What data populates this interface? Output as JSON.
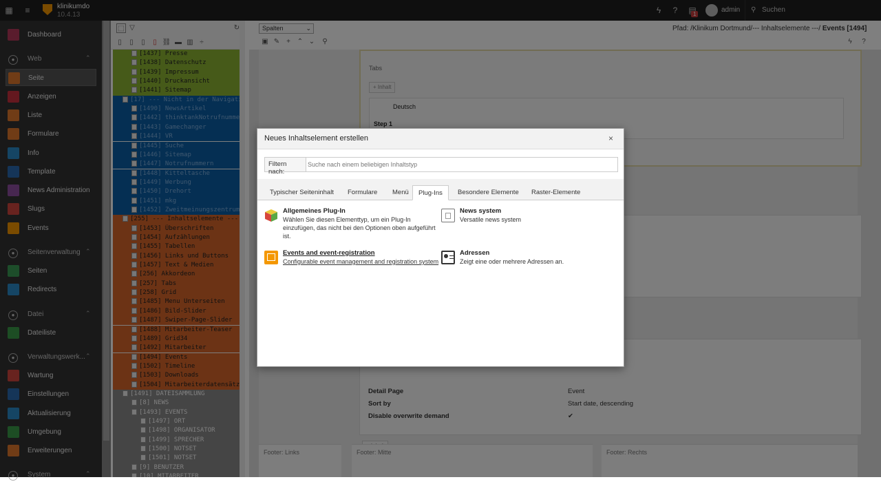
{
  "topbar": {
    "site_name": "klinikumdo",
    "version": "10.4.13",
    "username": "admin",
    "search_label": "Suchen",
    "badge_count": "1"
  },
  "sidebar": {
    "sections": [
      {
        "label": "Web",
        "items": [
          "Seite",
          "Anzeigen",
          "Liste",
          "Formulare",
          "Info",
          "Template",
          "News Administration",
          "Slugs",
          "Events"
        ]
      },
      {
        "label": "Seitenverwaltung",
        "items": [
          "Seiten",
          "Redirects"
        ]
      },
      {
        "label": "Datei",
        "items": [
          "Dateiliste"
        ]
      },
      {
        "label": "Verwaltungswerk...",
        "items": [
          "Wartung",
          "Einstellungen",
          "Aktualisierung",
          "Umgebung",
          "Erweiterungen"
        ]
      },
      {
        "label": "System",
        "items": []
      }
    ],
    "dashboard": "Dashboard",
    "active": "Seite",
    "item_colors": {
      "Dashboard": "#b5385b",
      "Seite": "#e0782c",
      "Anzeigen": "#c8313f",
      "Liste": "#e0782c",
      "Formulare": "#e0782c",
      "Info": "#2b8ac8",
      "Template": "#2b6bb0",
      "News Administration": "#8f4fa0",
      "Slugs": "#d0463e",
      "Events": "#f49700",
      "Seiten": "#3b9b55",
      "Redirects": "#2b8ac8",
      "Dateiliste": "#3a9b48",
      "Wartung": "#d0463e",
      "Einstellungen": "#2b6bb0",
      "Aktualisierung": "#2b8ac8",
      "Umgebung": "#3a9b48",
      "Erweiterungen": "#e0782c"
    }
  },
  "tree": {
    "nodes": [
      {
        "text": "[1437] Presse",
        "color": "#8db533",
        "indent": 1
      },
      {
        "text": "[1438] Datenschutz",
        "color": "#8db533",
        "indent": 1
      },
      {
        "text": "[1439] Impressum",
        "color": "#8db533",
        "indent": 1
      },
      {
        "text": "[1440] Druckansicht",
        "color": "#8db533",
        "indent": 1
      },
      {
        "text": "[1441] Sitemap",
        "color": "#8db533",
        "indent": 1
      },
      {
        "text": "[17] --- Nicht in der Navigation ---",
        "color": "#0a5fa6",
        "indent": 0
      },
      {
        "text": "[1490] NewsArtikel",
        "color": "#0a5fa6",
        "indent": 1
      },
      {
        "text": "[1442] thinktankNotrufnummer",
        "color": "#0a5fa6",
        "indent": 1
      },
      {
        "text": "[1443] Gamechanger",
        "color": "#0a5fa6",
        "indent": 1
      },
      {
        "text": "[1444] VR",
        "color": "#0a5fa6",
        "indent": 1
      },
      {
        "text": "[1445] Suche",
        "color": "#0a5fa6",
        "indent": 1
      },
      {
        "text": "[1446] Sitemap",
        "color": "#0a5fa6",
        "indent": 1
      },
      {
        "text": "[1447] Notrufnummern",
        "color": "#0a5fa6",
        "indent": 1
      },
      {
        "text": "[1448] Kitteltasche",
        "color": "#0a5fa6",
        "indent": 1
      },
      {
        "text": "[1449] Werbung",
        "color": "#0a5fa6",
        "indent": 1
      },
      {
        "text": "[1450] Drehort",
        "color": "#0a5fa6",
        "indent": 1
      },
      {
        "text": "[1451] mkg",
        "color": "#0a5fa6",
        "indent": 1
      },
      {
        "text": "[1452] Zweitmeinungszentrum",
        "color": "#0a5fa6",
        "indent": 1
      },
      {
        "text": "[255] --- Inhaltselemente ---",
        "color": "#d9662a",
        "indent": 0
      },
      {
        "text": "[1453] Überschriften",
        "color": "#d9662a",
        "indent": 1
      },
      {
        "text": "[1454] Aufzählungen",
        "color": "#d9662a",
        "indent": 1
      },
      {
        "text": "[1455] Tabellen",
        "color": "#d9662a",
        "indent": 1
      },
      {
        "text": "[1456] Links und Buttons",
        "color": "#d9662a",
        "indent": 1
      },
      {
        "text": "[1457] Text & Medien",
        "color": "#d9662a",
        "indent": 1
      },
      {
        "text": "[256] Akkordeon",
        "color": "#d9662a",
        "indent": 1
      },
      {
        "text": "[257] Tabs",
        "color": "#d9662a",
        "indent": 1
      },
      {
        "text": "[258] Grid",
        "color": "#d9662a",
        "indent": 1
      },
      {
        "text": "[1485] Menu Unterseiten",
        "color": "#d9662a",
        "indent": 1
      },
      {
        "text": "[1486] Bild-Slider",
        "color": "#d9662a",
        "indent": 1
      },
      {
        "text": "[1487] Swiper-Page-Slider",
        "color": "#d9662a",
        "indent": 1
      },
      {
        "text": "[1488] Mitarbeiter-Teaser",
        "color": "#d9662a",
        "indent": 1
      },
      {
        "text": "[1489] Grid34",
        "color": "#d9662a",
        "indent": 1
      },
      {
        "text": "[1492] Mitarbeiter",
        "color": "#d9662a",
        "indent": 1
      },
      {
        "text": "[1494] Events",
        "color": "#d9662a",
        "indent": 1
      },
      {
        "text": "[1502] Timeline",
        "color": "#d9662a",
        "indent": 1
      },
      {
        "text": "[1503] Downloads",
        "color": "#d9662a",
        "indent": 1
      },
      {
        "text": "[1504] Mitarbeiterdatensätze",
        "color": "#d9662a",
        "indent": 1
      },
      {
        "text": "[1491] DATEISAMMLUNG",
        "color": "#8a8a8a",
        "indent": 0
      },
      {
        "text": "[8] NEWS",
        "color": "#8a8a8a",
        "indent": 1
      },
      {
        "text": "[1493] EVENTS",
        "color": "#8a8a8a",
        "indent": 1
      },
      {
        "text": "[1497] ORT",
        "color": "#8a8a8a",
        "indent": 2
      },
      {
        "text": "[1498] ORGANISATOR",
        "color": "#8a8a8a",
        "indent": 2
      },
      {
        "text": "[1499] SPRECHER",
        "color": "#8a8a8a",
        "indent": 2
      },
      {
        "text": "[1500] NOTSET",
        "color": "#8a8a8a",
        "indent": 2
      },
      {
        "text": "[1501] NOTSET",
        "color": "#8a8a8a",
        "indent": 2
      },
      {
        "text": "[9] BENUTZER",
        "color": "#8a8a8a",
        "indent": 1
      },
      {
        "text": "[10] MITARBEITER",
        "color": "#8a8a8a",
        "indent": 1
      }
    ]
  },
  "content": {
    "view_select": "Spalten",
    "path_prefix": "Pfad: /Klinikum Dortmund/--- Inhaltselemente ---/",
    "path_page": "Events [1494]",
    "tabs_label": "Tabs",
    "inhalt_label": "+ Inhalt",
    "lang_label": "Deutsch",
    "step_label": "Step 1",
    "details": [
      {
        "key": "Detail Page",
        "value": "Event"
      },
      {
        "key": "Sort by",
        "value": "Start date, descending"
      },
      {
        "key": "Disable overwrite demand",
        "value": "✔"
      }
    ],
    "footers": [
      "Footer: Links",
      "Footer: Mitte",
      "Footer: Rechts"
    ]
  },
  "modal": {
    "title": "Neues Inhaltselement erstellen",
    "close": "×",
    "filter_label": "Filtern nach:",
    "filter_placeholder": "Suche nach einem beliebigen Inhaltstyp",
    "tabs": [
      "Typischer Seiteninhalt",
      "Formulare",
      "Menü",
      "Plug-Ins",
      "Besondere Elemente",
      "Raster-Elemente"
    ],
    "active_tab": "Plug-Ins",
    "items": [
      {
        "title": "Allgemeines Plug-In",
        "desc": "Wählen Sie diesen Elementtyp, um ein Plug-In einzufügen, das nicht bei den Optionen oben aufgeführt ist.",
        "icon": "cube-icon"
      },
      {
        "title": "News system",
        "desc": "Versatile news system",
        "icon": "news-icon"
      },
      {
        "title": "Events and event-registration",
        "desc": "Configurable event management and registration system",
        "icon": "calendar-icon"
      },
      {
        "title": "Adressen",
        "desc": "Zeigt eine oder mehrere Adressen an.",
        "icon": "address-card-icon"
      }
    ]
  }
}
